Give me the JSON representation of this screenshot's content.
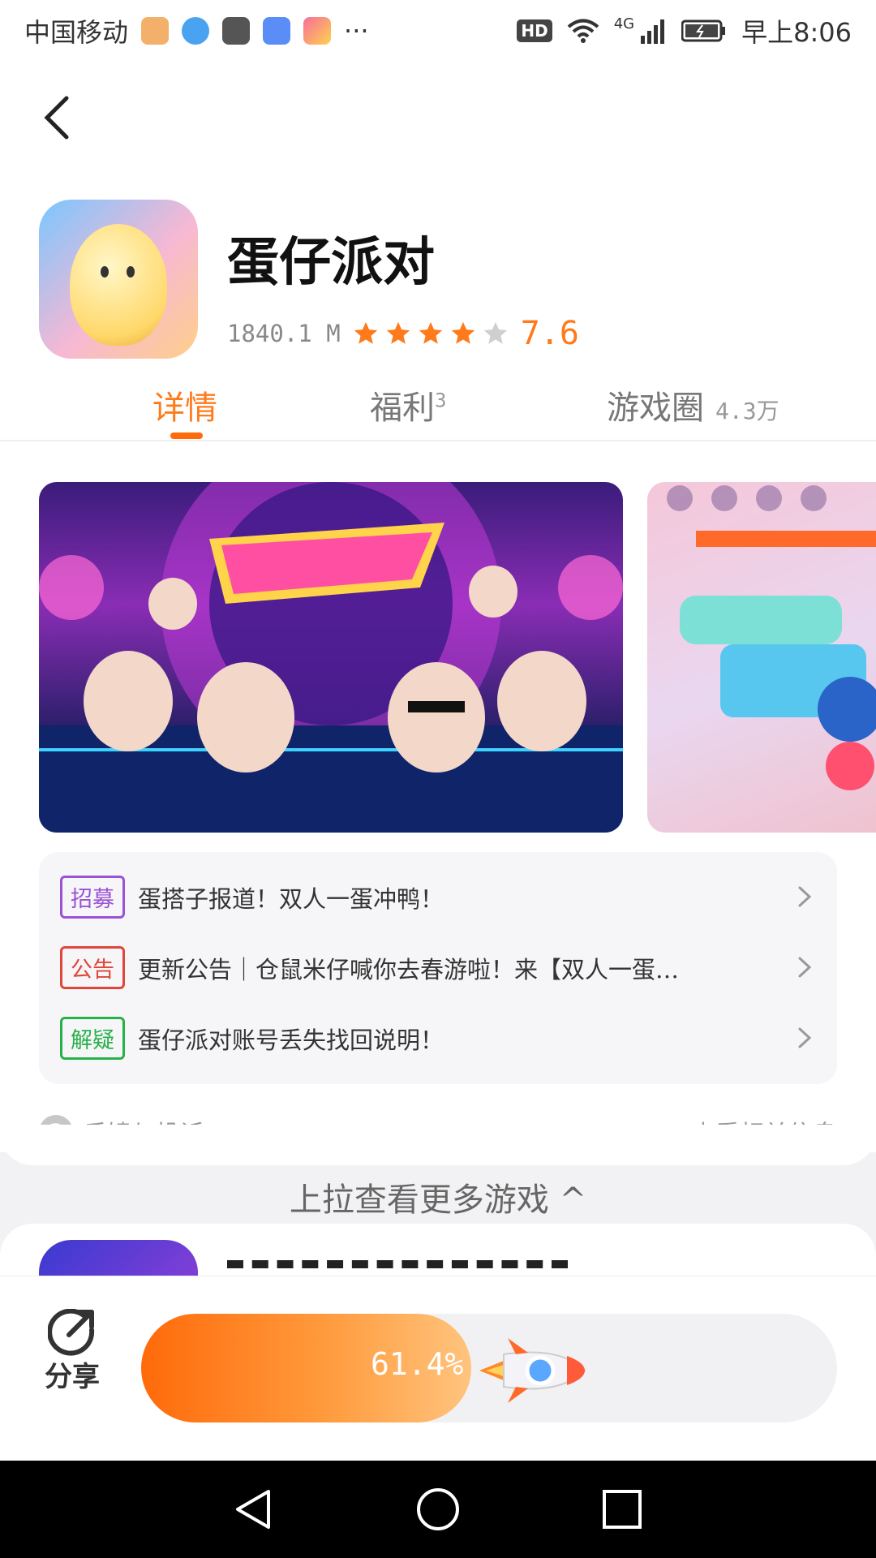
{
  "status_bar": {
    "carrier": "中国移动",
    "more_icons": "···",
    "hd": "HD",
    "network": "4G",
    "time": "早上8:06"
  },
  "app": {
    "name": "蛋仔派对",
    "size": "1840.1 M",
    "rating": "7.6",
    "stars_filled": 4,
    "stars_total": 5,
    "accent_color": "#ff7a1a"
  },
  "tabs": [
    {
      "label": "详情",
      "badge": "",
      "active": true
    },
    {
      "label": "福利",
      "badge": "3",
      "active": false
    },
    {
      "label": "游戏圈",
      "badge": "4.3万",
      "active": false
    }
  ],
  "notices": [
    {
      "tag": "招募",
      "tag_color": "#9a52d6",
      "text": "蛋搭子报道！双人一蛋冲鸭！"
    },
    {
      "tag": "公告",
      "tag_color": "#e0463a",
      "text": "更新公告｜仓鼠米仔喊你去春游啦！来【双人一蛋…"
    },
    {
      "tag": "解疑",
      "tag_color": "#28b04a",
      "text": "蛋仔派对账号丢失找回说明！"
    }
  ],
  "feedback": {
    "left": "反馈与投诉",
    "right": "查看相关信息"
  },
  "more_games": "上拉查看更多游戏 ^",
  "bottom": {
    "share_label": "分享",
    "progress_text": "61.4%",
    "progress_value": 0.614
  }
}
